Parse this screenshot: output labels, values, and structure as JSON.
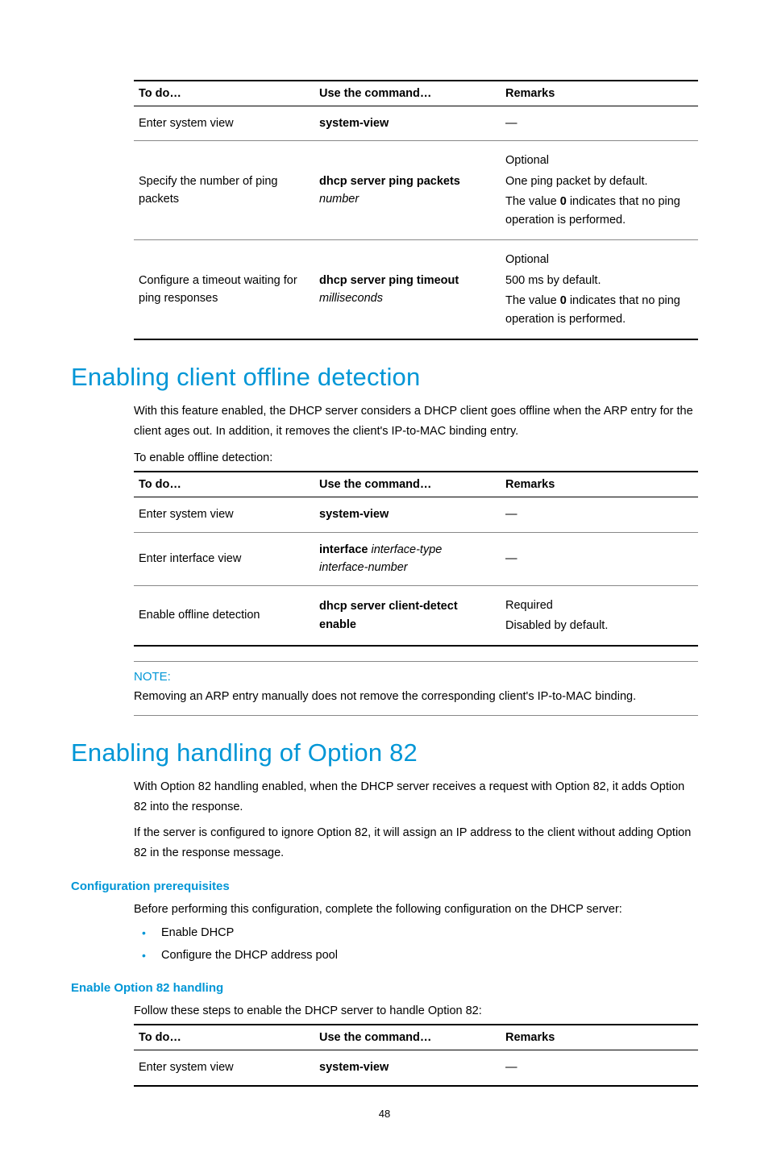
{
  "table1": {
    "headers": [
      "To do…",
      "Use the command…",
      "Remarks"
    ],
    "rows": [
      {
        "todo": "Enter system view",
        "cmd_bold": "system-view",
        "cmd_ital": "",
        "remarks_dash": "—",
        "remarks_opt": "",
        "remarks_line1": "",
        "remarks_line2_pre": "",
        "remarks_line2_bold": "",
        "remarks_line2_post": ""
      },
      {
        "todo": "Specify the number of ping packets",
        "cmd_bold": "dhcp server ping packets",
        "cmd_ital": "number",
        "remarks_dash": "",
        "remarks_opt": "Optional",
        "remarks_line1": "One ping packet by default.",
        "remarks_line2_pre": "The value ",
        "remarks_line2_bold": "0",
        "remarks_line2_post": " indicates that no ping operation is performed."
      },
      {
        "todo": "Configure a timeout waiting for ping responses",
        "cmd_bold": "dhcp server ping timeout",
        "cmd_ital": "milliseconds",
        "remarks_dash": "",
        "remarks_opt": "Optional",
        "remarks_line1": "500 ms by default.",
        "remarks_line2_pre": "The value ",
        "remarks_line2_bold": "0",
        "remarks_line2_post": " indicates that no ping operation is performed."
      }
    ]
  },
  "section1": {
    "title": "Enabling client offline detection",
    "para1": "With this feature enabled, the DHCP server considers a DHCP client goes offline when the ARP entry for the client ages out. In addition, it removes the client's IP-to-MAC binding entry.",
    "lead": "To enable offline detection:"
  },
  "table2": {
    "headers": [
      "To do…",
      "Use the command…",
      "Remarks"
    ],
    "rows": [
      {
        "todo": "Enter system view",
        "cmd_bold": "system-view",
        "cmd_ital": "",
        "cmd_bold2": "",
        "remarks_dash": "—",
        "remarks_req": "",
        "remarks_line1": ""
      },
      {
        "todo": "Enter interface view",
        "cmd_bold": "interface",
        "cmd_ital": " interface-type interface-number",
        "cmd_bold2": "",
        "remarks_dash": "—",
        "remarks_req": "",
        "remarks_line1": ""
      },
      {
        "todo": "Enable offline detection",
        "cmd_bold": "dhcp server client-detect enable",
        "cmd_ital": "",
        "cmd_bold2": "",
        "remarks_dash": "",
        "remarks_req": "Required",
        "remarks_line1": "Disabled by default."
      }
    ]
  },
  "note1": {
    "label": "NOTE:",
    "text": "Removing an ARP entry manually does not remove the corresponding client's IP-to-MAC binding."
  },
  "section2": {
    "title": "Enabling handling of Option 82",
    "para1": "With Option 82 handling enabled, when the DHCP server receives a request with Option 82, it adds Option 82 into the response.",
    "para2": "If the server is configured to ignore Option 82, it will assign an IP address to the client without adding Option 82 in the response message.",
    "sub1": "Configuration prerequisites",
    "sub1_para": "Before performing this configuration, complete the following configuration on the DHCP server:",
    "bullets": [
      "Enable DHCP",
      "Configure the DHCP address pool"
    ],
    "sub2": "Enable Option 82 handling",
    "sub2_para": "Follow these steps to enable the DHCP server to handle Option 82:"
  },
  "table3": {
    "headers": [
      "To do…",
      "Use the command…",
      "Remarks"
    ],
    "rows": [
      {
        "todo": "Enter system view",
        "cmd_bold": "system-view",
        "remarks_dash": "—"
      }
    ]
  },
  "page_number": "48"
}
